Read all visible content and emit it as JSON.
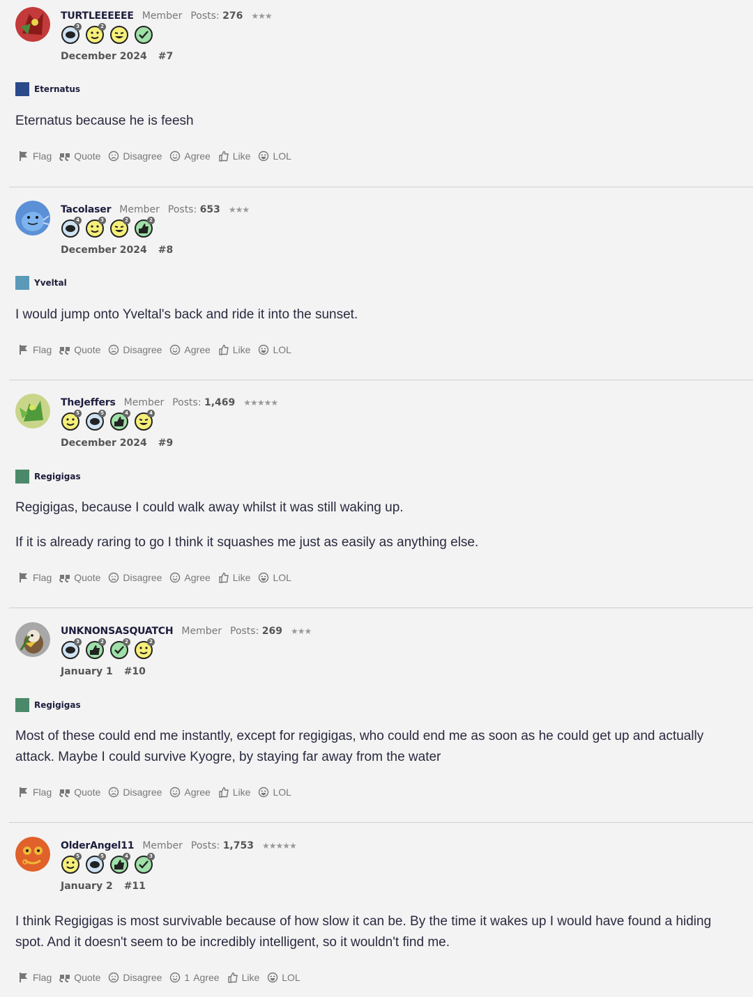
{
  "actions": {
    "flag": "Flag",
    "quote": "Quote",
    "disagree": "Disagree",
    "agree": "Agree",
    "like": "Like",
    "lol": "LOL"
  },
  "posts": [
    {
      "username": "TURTLEEEEEE",
      "role": "Member",
      "posts_label": "Posts:",
      "posts_count": "276",
      "stars": "★★★",
      "badges": [
        "3",
        "2",
        "",
        ""
      ],
      "date": "December 2024",
      "number": "#7",
      "vote_label": "Eternatus",
      "vote_color": "#2b4a8a",
      "paragraphs": [
        "Eternatus because he is feesh"
      ],
      "agree_count": ""
    },
    {
      "username": "Tacolaser",
      "role": "Member",
      "posts_label": "Posts:",
      "posts_count": "653",
      "stars": "★★★",
      "badges": [
        "4",
        "3",
        "2",
        "2"
      ],
      "date": "December 2024",
      "number": "#8",
      "vote_label": "Yveltal",
      "vote_color": "#5a9ab8",
      "paragraphs": [
        "I would jump onto Yveltal's back and ride it into the sunset."
      ],
      "agree_count": ""
    },
    {
      "username": "TheJeffers",
      "role": "Member",
      "posts_label": "Posts:",
      "posts_count": "1,469",
      "stars": "★★★★★",
      "badges": [
        "5",
        "5",
        "4",
        "4"
      ],
      "date": "December 2024",
      "number": "#9",
      "vote_label": "Regigigas",
      "vote_color": "#4a8a6a",
      "paragraphs": [
        "Regigigas, because I could walk away whilst it was still waking up.",
        "If it is already raring to go I think it squashes me just as easily as anything else."
      ],
      "agree_count": ""
    },
    {
      "username": "UNKNONSASQUATCH",
      "role": "Member",
      "posts_label": "Posts:",
      "posts_count": "269",
      "stars": "★★★",
      "badges": [
        "3",
        "2",
        "2",
        "2"
      ],
      "date": "January 1",
      "number": "#10",
      "vote_label": "Regigigas",
      "vote_color": "#4a8a6a",
      "paragraphs": [
        "Most of these could end me instantly, except for regigigas, who could end me as soon as he could get up and actually attack. Maybe I could survive Kyogre, by staying far away from the water"
      ],
      "agree_count": ""
    },
    {
      "username": "OlderAngel11",
      "role": "Member",
      "posts_label": "Posts:",
      "posts_count": "1,753",
      "stars": "★★★★★",
      "badges": [
        "5",
        "5",
        "4",
        "3"
      ],
      "date": "January 2",
      "number": "#11",
      "vote_label": "",
      "vote_color": "",
      "paragraphs": [
        "I think Regigigas is most survivable because of how slow it can be. By the time it wakes up I would have found a hiding spot. And it doesn't seem to be incredibly intelligent, so it wouldn't find me."
      ],
      "agree_count": "1"
    }
  ]
}
